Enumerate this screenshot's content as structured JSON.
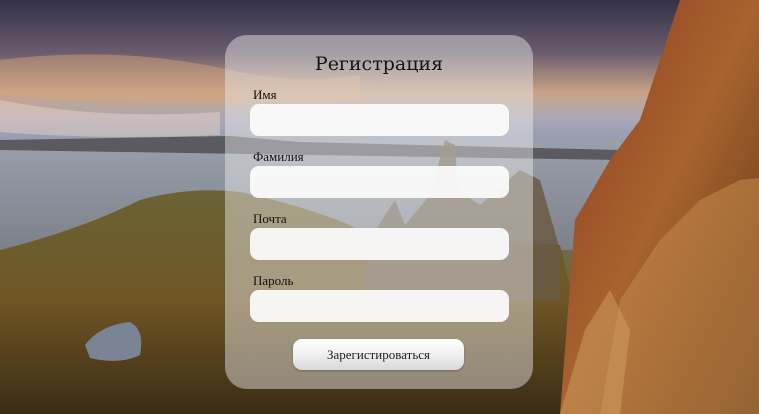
{
  "form": {
    "title": "Регистрация",
    "fields": [
      {
        "label": "Имя",
        "value": "",
        "placeholder": ""
      },
      {
        "label": "Фамилия",
        "value": "",
        "placeholder": ""
      },
      {
        "label": "Почта",
        "value": "",
        "placeholder": ""
      },
      {
        "label": "Пароль",
        "value": "",
        "placeholder": ""
      }
    ],
    "submit_label": "Зарегистироваться"
  }
}
